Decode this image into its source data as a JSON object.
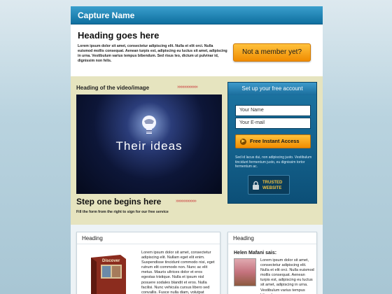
{
  "header": {
    "title": "Capture Name"
  },
  "hero": {
    "heading": "Heading goes here",
    "body": "Lorem ipsum dolor sit amet, consectetur adipiscing elit. Nulla et elit orci. Nulla euismod mollis consequat. Aenean turpis est, adipiscing eu luctus sit amet, adipiscing in urna. Vestibulum varius tempus bibendum. Sed risus leo, dictum ut pulvinar id, dignissim non felis.",
    "member_button": "Not a member yet?"
  },
  "video": {
    "heading": "Heading of the video/image",
    "logo_text": "Their ideas",
    "arrows": "»»»»»»»»»»"
  },
  "step": {
    "heading": "Step one begins here",
    "subtext": "Fill the form from the right to sign for our free service",
    "arrows": "»»»»»»»»»»"
  },
  "signup": {
    "title": "Set up your free account",
    "name_placeholder": "Your Name",
    "email_placeholder": "Your E-mail",
    "cta_label": "Free Instant Access",
    "fine_print": "Sed id lacus dui, non adipiscing justo. Vestibulum tincidunt fermentum justo, eu dignissim tortor fermentum ac.",
    "trusted_line1": "TRUSTED",
    "trusted_line2": "WEBSITE"
  },
  "cards": {
    "left": {
      "heading": "Heading",
      "text": "Lorem ipsum dolor sit amet, consectetur adipiscing elit. Nullam eget elit enim. Suspendisse tincidunt commodo nisi, eget rutrum elit commodo non. Nunc ac elit metus. Mauris ultrices dolor et eros egestas tristique. Nulla et ipsum nisl posuere sodales blandit et eros. Nulla facilisi. Nunc vehicula cursus libero sed convallis. Fusce nulla diam, volutpat placerat interdum ut, auctor vitae lectus.",
      "book_title": "Discover"
    },
    "right": {
      "heading": "Heading",
      "author": "Helen Mafani sais:",
      "text": "Lorem ipsum dolor sit amet, consectetur adipiscing elit. Nulla et elit orci. Nulla euismod mollis consequat. Aenean turpis est, adipiscing eu luctus sit amet, adipiscing in urna. Vestibulum varius tempus bibendum."
    }
  },
  "colors": {
    "header_blue": "#1a85b8",
    "cta_orange": "#f5a11a",
    "band_beige": "#e6e4bf",
    "arrow_red": "#cc4444"
  }
}
